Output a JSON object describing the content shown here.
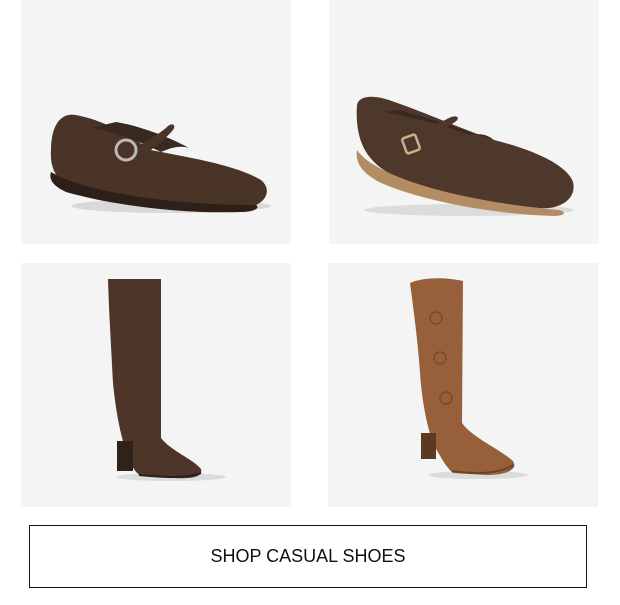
{
  "products": [
    {
      "name": "brown mary jane flat with round buckle",
      "icon": "mary-jane-flat-round-buckle-image"
    },
    {
      "name": "brown mary jane flat with square buckle",
      "icon": "mary-jane-flat-square-buckle-image"
    },
    {
      "name": "brown knee-high block heel boot",
      "icon": "knee-high-suede-boot-image"
    },
    {
      "name": "cognac western knee-high boot",
      "icon": "western-knee-high-boot-image"
    }
  ],
  "cta": {
    "label": "SHOP CASUAL SHOES"
  },
  "colors": {
    "tile_background": "#f4f4f4",
    "dark_brown": "#4a3428",
    "cognac": "#9a5a34",
    "border": "#111111"
  }
}
